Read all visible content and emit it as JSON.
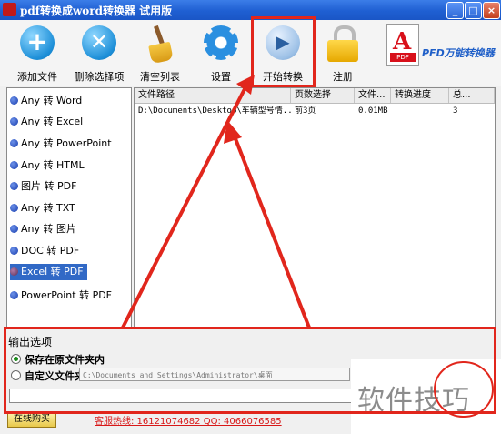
{
  "window": {
    "title": "pdf转换成word转换器 试用版",
    "buttons": {
      "minimize": "_",
      "maximize": "□",
      "close": "×"
    }
  },
  "toolbar": {
    "items": [
      {
        "label": "添加文件",
        "icon": "add-icon"
      },
      {
        "label": "删除选择项",
        "icon": "delete-icon"
      },
      {
        "label": "清空列表",
        "icon": "broom-icon"
      },
      {
        "label": "设置",
        "icon": "gear-icon"
      },
      {
        "label": "开始转换",
        "icon": "play-icon"
      },
      {
        "label": "注册",
        "icon": "lock-icon"
      }
    ],
    "brand": "PFD万能转换器",
    "pdf_logo_text": "PDF"
  },
  "conversion_types": [
    {
      "label": "Any 转 Word",
      "selected": false
    },
    {
      "label": "Any 转 Excel",
      "selected": false
    },
    {
      "label": "Any 转 PowerPoint",
      "selected": false
    },
    {
      "label": "Any 转 HTML",
      "selected": false
    },
    {
      "label": "图片 转 PDF",
      "selected": false
    },
    {
      "label": "Any 转 TXT",
      "selected": false
    },
    {
      "label": "Any 转 图片",
      "selected": false
    },
    {
      "label": "DOC 转 PDF",
      "selected": false
    },
    {
      "label": "Excel 转 PDF",
      "selected": true
    },
    {
      "label": "PowerPoint 转 PDF",
      "selected": false
    }
  ],
  "file_table": {
    "columns": [
      "文件路径",
      "页数选择",
      "文件...",
      "转换进度",
      "总..."
    ],
    "rows": [
      {
        "path": "D:\\Documents\\Desktop\\车辆型号情...",
        "pages": "前3页",
        "size": "0.01MB",
        "progress": "",
        "total": "3"
      }
    ]
  },
  "output": {
    "section_label": "输出选项",
    "option_same": "保存在原文件夹内",
    "option_custom": "自定义文件夹",
    "custom_path": "C:\\Documents and Settings\\Administrator\\桌面",
    "selected": "same"
  },
  "footer": {
    "buy_button": "在线购买",
    "contact": "客服热线: 16121074682 QQ: 4066076585"
  },
  "watermark": "软件技巧",
  "colors": {
    "accent": "#3169c6",
    "annotation": "#e1261c"
  }
}
